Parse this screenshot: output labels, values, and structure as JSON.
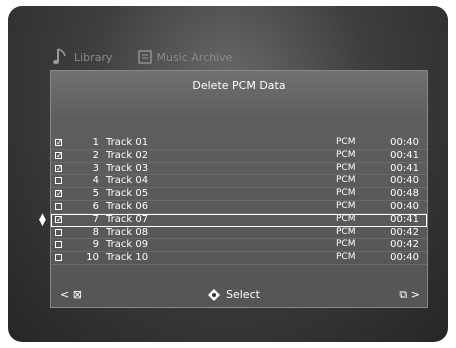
{
  "tabs": [
    {
      "label": "Library"
    },
    {
      "label": "Music Archive"
    }
  ],
  "dialog_title": "Delete PCM Data",
  "tracks": [
    {
      "number": "1",
      "name": "Track 01",
      "format": "PCM",
      "duration": "00:40",
      "checked": true
    },
    {
      "number": "2",
      "name": "Track 02",
      "format": "PCM",
      "duration": "00:41",
      "checked": true
    },
    {
      "number": "3",
      "name": "Track 03",
      "format": "PCM",
      "duration": "00:41",
      "checked": true
    },
    {
      "number": "4",
      "name": "Track 04",
      "format": "PCM",
      "duration": "00:40",
      "checked": false
    },
    {
      "number": "5",
      "name": "Track 05",
      "format": "PCM",
      "duration": "00:48",
      "checked": true
    },
    {
      "number": "6",
      "name": "Track 06",
      "format": "PCM",
      "duration": "00:40",
      "checked": false
    },
    {
      "number": "7",
      "name": "Track 07",
      "format": "PCM",
      "duration": "00:41",
      "checked": true,
      "selected": true
    },
    {
      "number": "8",
      "name": "Track 08",
      "format": "PCM",
      "duration": "00:42",
      "checked": false
    },
    {
      "number": "9",
      "name": "Track 09",
      "format": "PCM",
      "duration": "00:42",
      "checked": false
    },
    {
      "number": "10",
      "name": "Track 10",
      "format": "PCM",
      "duration": "00:40",
      "checked": false
    }
  ],
  "footer": {
    "left_glyph": "< ⊠",
    "select_label": "Select",
    "right_glyph": "⧉ >"
  }
}
